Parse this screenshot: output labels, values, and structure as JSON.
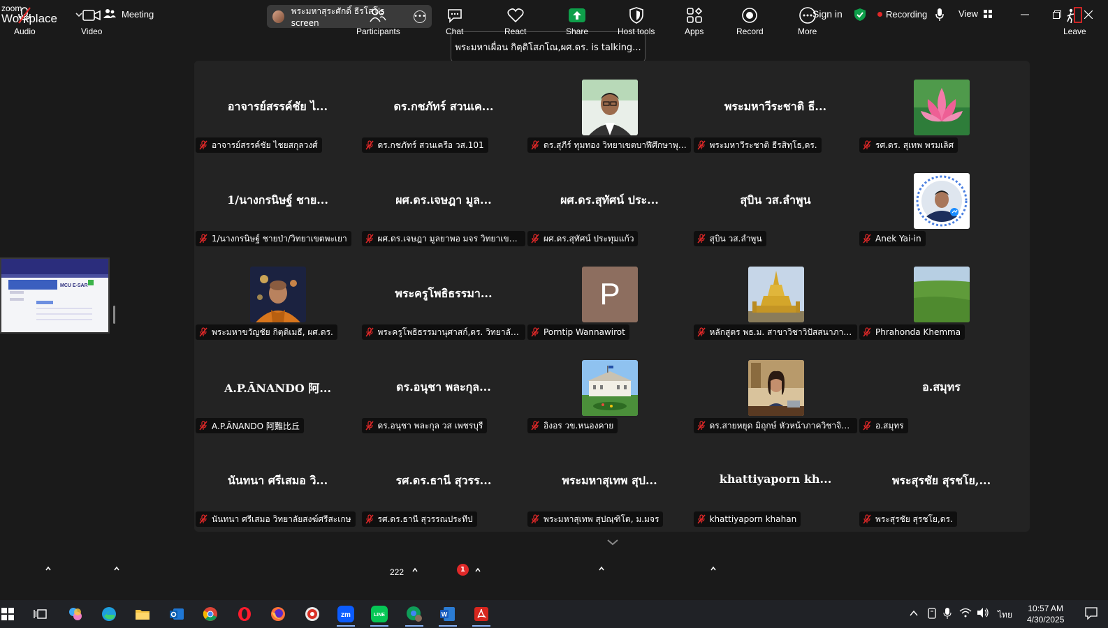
{
  "app": {
    "logo_top": "zoom",
    "logo_bottom": "Workplace",
    "meeting_label": "Meeting",
    "screen_share_label": "พระมหาสุระศักดิ์ ธีรโสโ's screen",
    "sign_in": "Sign in",
    "recording_label": "Recording",
    "view_label": "View"
  },
  "talking": "พระมหาเผื่อน กิตฺติโสภโณ,ผศ.ดร. is talking...",
  "tiles": [
    {
      "big": "อาจารย์สรรค์ชัย ไ...",
      "name": "อาจารย์สรรค์ชัย ไชยสกุลวงศ์",
      "photo": ""
    },
    {
      "big": "ดร.กชภัทร์ สวนเค...",
      "name": "ดร.กชภัทร์ สวนเครือ วส.101",
      "photo": ""
    },
    {
      "big": "",
      "name": "ดร.สุภีร์ ทุมทอง วิทยาเขตบาฬีศึกษาพุทธโ...",
      "photo": "man-glasses"
    },
    {
      "big": "พระมหาวีระชาติ ธี...",
      "name": "พระมหาวีระชาติ ธีรสิทฺโธ,ดร.",
      "photo": ""
    },
    {
      "big": "",
      "name": "รศ.ดร. สุเทพ พรมเลิศ",
      "photo": "lotus"
    },
    {
      "big": "1/นางกรนิษฐ์ ชาย...",
      "name": "1/นางกรนิษฐ์ ชายป่า/วิทยาเขตพะเยา",
      "photo": ""
    },
    {
      "big": "ผศ.ดร.เจษฎา  มูล...",
      "name": "ผศ.ดร.เจษฎา  มูลยาพอ มจร วิทยาเขตหน...",
      "photo": ""
    },
    {
      "big": "ผศ.ดร.สุทัศน์ ประ...",
      "name": "ผศ.ดร.สุทัศน์ ประทุมแก้ว",
      "photo": ""
    },
    {
      "big": "สุบิน วส.ลำพูน",
      "name": "สุบิน วส.ลำพูน",
      "photo": ""
    },
    {
      "big": "",
      "name": "Anek Yai-in",
      "photo": "messenger"
    },
    {
      "big": "",
      "name": "พระมหาขวัญชัย กิตฺติเมธี, ผศ.ดร.",
      "photo": "monk"
    },
    {
      "big": "พระครูโพธิธรรมา...",
      "name": "พระครูโพธิธรรมานุศาสก์,ดร. วิทยาลัยสงฆ์...",
      "photo": ""
    },
    {
      "big": "",
      "name": "Porntip Wannawirot",
      "photo": "letter-p"
    },
    {
      "big": "",
      "name": "หลักสูตร พธ.ม. สาขาวิชาวิปัสสนาภาวนา...",
      "photo": "stupa"
    },
    {
      "big": "",
      "name": "Phrahonda Khemma",
      "photo": "field"
    },
    {
      "big": "A.P.ĀNANDO 阿...",
      "name": "A.P.ĀNANDO 阿難比丘",
      "photo": ""
    },
    {
      "big": "ดร.อนุชา พละกุล...",
      "name": "ดร.อนุชา พละกุล วส เพชรบุรี",
      "photo": ""
    },
    {
      "big": "",
      "name": "อิงอร วข.หนองคาย",
      "photo": "building"
    },
    {
      "big": "",
      "name": "ดร.สายหยุด มิถุกษ์ หัวหน้าภาควิชาจิตวิท...",
      "photo": "woman-desk"
    },
    {
      "big": "อ.สมุทร",
      "name": "อ.สมุทร",
      "photo": ""
    },
    {
      "big": "นันทนา ศรีเสมอ วิ...",
      "name": "นันทนา ศรีเสมอ วิทยาลัยสงฆ์ศรีสะเกษ",
      "photo": ""
    },
    {
      "big": "รศ.ดร.ธานี สุวรร...",
      "name": "รศ.ดร.ธานี สุวรรณประทีป",
      "photo": ""
    },
    {
      "big": "พระมหาสุเทพ สุป...",
      "name": "พระมหาสุเทพ สุปณฺฑิโต, ม.มจร",
      "photo": ""
    },
    {
      "big": "khattiyaporn kh...",
      "name": "khattiyaporn khahan",
      "photo": ""
    },
    {
      "big": "พระสุรชัย สุรชโย,...",
      "name": "พระสุรชัย  สุรชโย,ดร.",
      "photo": ""
    }
  ],
  "letter_p": "P",
  "preview": {
    "title": "MCU E-SAR"
  },
  "toolbar": {
    "audio": "Audio",
    "video": "Video",
    "participants": "Participants",
    "participants_count": "222",
    "chat": "Chat",
    "chat_badge": "1",
    "react": "React",
    "share": "Share",
    "host_tools": "Host tools",
    "apps": "Apps",
    "record": "Record",
    "more": "More",
    "leave": "Leave"
  },
  "taskbar": {
    "lang": "ไทย",
    "time": "10:57 AM",
    "date": "4/30/2025"
  },
  "colors": {
    "accent_green": "#0e9f4a",
    "record_red": "#e02828",
    "mute_red": "#e02828"
  }
}
